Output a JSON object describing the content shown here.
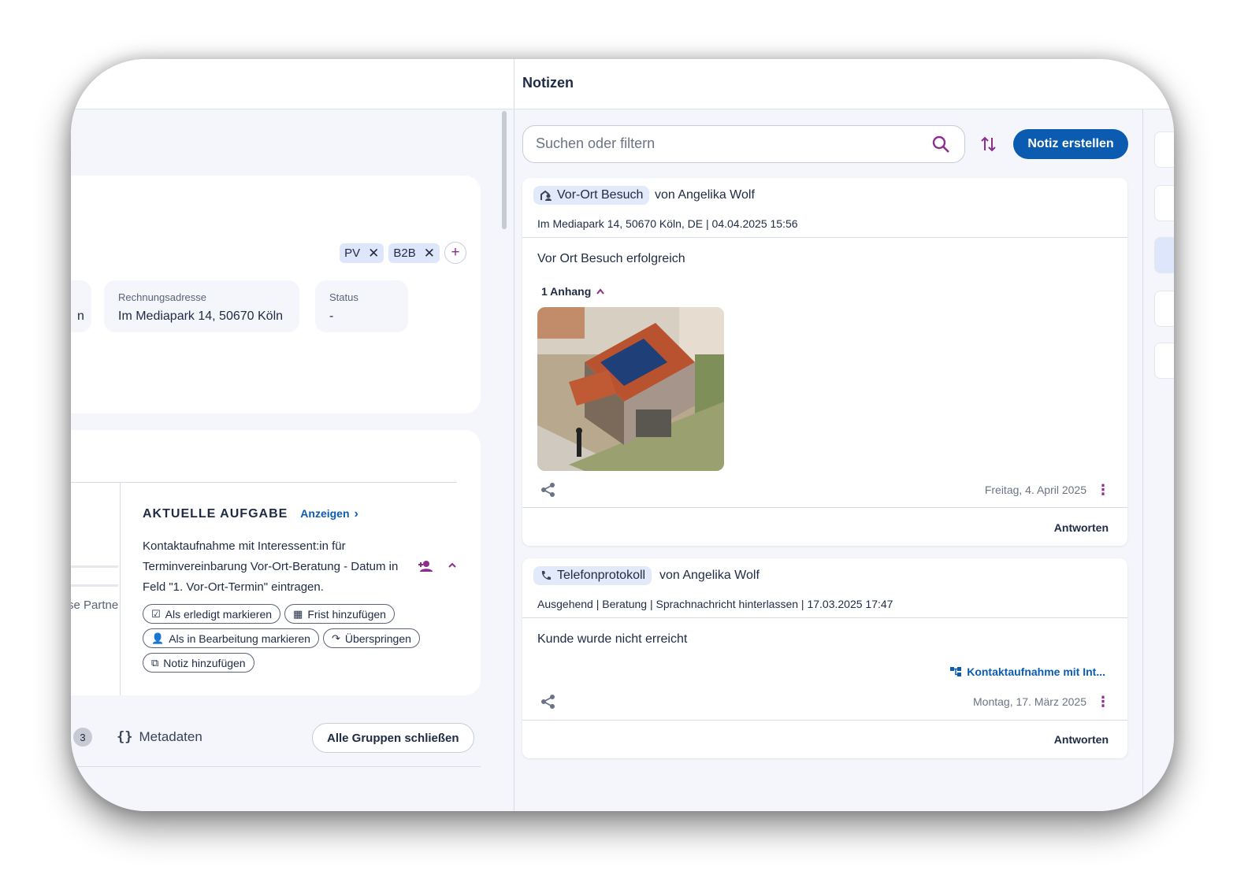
{
  "left": {
    "tags": [
      {
        "label": "PV"
      },
      {
        "label": "B2B"
      }
    ],
    "fields": {
      "partial_value": "n",
      "billing": {
        "label": "Rechnungsadresse",
        "value": "Im Mediapark 14, 50670 Köln"
      },
      "status": {
        "label": "Status",
        "value": "-"
      }
    },
    "partner_text": "se Partne",
    "task": {
      "title": "AKTUELLE AUFGABE",
      "link": "Anzeigen",
      "description": "Kontaktaufnahme mit Interessent:in für Terminvereinbarung Vor-Ort-Beratung - Datum in Feld \"1. Vor-Ort-Termin\" eintragen.",
      "buttons": {
        "done": "Als erledigt markieren",
        "deadline": "Frist hinzufügen",
        "in_progress": "Als in Bearbeitung markieren",
        "skip": "Überspringen",
        "note": "Notiz hinzufügen"
      }
    },
    "bottom": {
      "badge": "3",
      "metadata": "Metadaten",
      "close_all": "Alle Gruppen schließen"
    }
  },
  "notes": {
    "title": "Notizen",
    "search_placeholder": "Suchen oder filtern",
    "create_button": "Notiz erstellen",
    "items": [
      {
        "type": "Vor-Ort Besuch",
        "author": "von Angelika Wolf",
        "meta": "Im Mediapark 14, 50670 Köln, DE  |  04.04.2025 15:56",
        "body": "Vor Ort Besuch erfolgreich",
        "attachments": "1 Anhang",
        "date": "Freitag, 4. April 2025",
        "reply": "Antworten"
      },
      {
        "type": "Telefonprotokoll",
        "author": "von Angelika Wolf",
        "meta": "Ausgehend  |  Beratung  |  Sprachnachricht hinterlassen  |  17.03.2025 17:47",
        "body": "Kunde wurde nicht erreicht",
        "linked_task": "Kontaktaufnahme mit Int...",
        "date": "Montag, 17. März 2025",
        "reply": "Antworten"
      }
    ]
  }
}
